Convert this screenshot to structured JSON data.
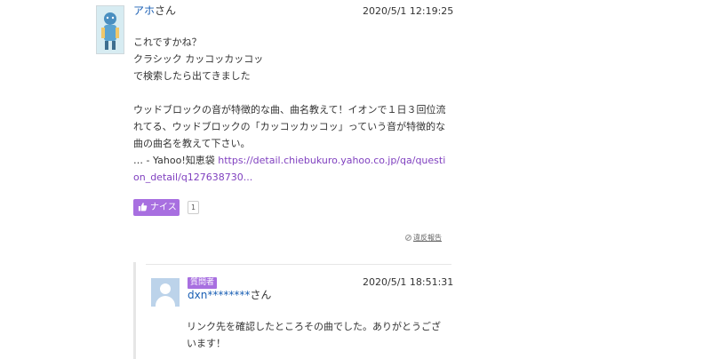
{
  "answer": {
    "user_name": "アホ",
    "user_suffix": "さん",
    "date": "2020/5/1  12:19:25",
    "lines": [
      "これですかね？",
      "クラシック カッコッカッコッ",
      "で検索したら出てきました"
    ],
    "quote": "ウッドブロックの音が特徴的な曲、曲名教えて！イオンで１日３回位流れてる、ウッドブロックの「カッコッカッコッ」っていう音が特徴的な曲の曲名を教えて下さい。",
    "source_prefix": "… - Yahoo!知恵袋 ",
    "source_link": "https://detail.chiebukuro.yahoo.co.jp/qa/question_detail/q127638730..."
  },
  "nice": {
    "label": "ナイス",
    "count": "1"
  },
  "report_label": "違反報告",
  "reply": {
    "badge": "質問者",
    "user_name": "dxn********",
    "user_suffix": "さん",
    "date": "2020/5/1  18:51:31",
    "text": "リンク先を確認したところその曲でした。ありがとうございます！"
  },
  "colors": {
    "accent": "#a86fe0",
    "user_link": "#1a5fb4",
    "url_link": "#7f3fbf"
  }
}
